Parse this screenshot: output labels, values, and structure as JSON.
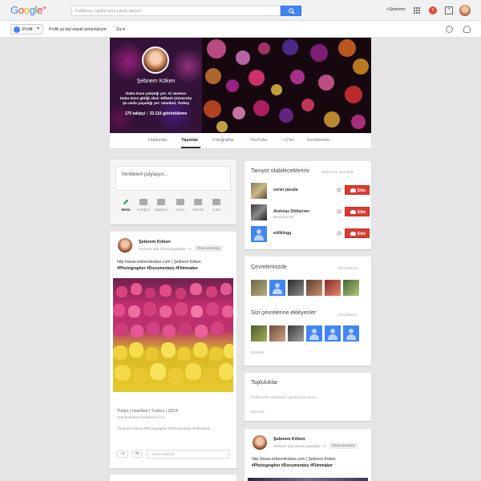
{
  "app": {
    "logo_text": "Google+",
    "search_placeholder": "Kullanıcı, sayfa veya yayın arayın",
    "user_link": "+Şebnem",
    "notification_count": "2"
  },
  "subbar": {
    "profile_label": "Profil",
    "view_as_text": "Profili şu kişi olarak görüntüleyin:",
    "view_as_value": "Siz"
  },
  "cover": {
    "name": "Şebnem Köken",
    "info_lines": [
      "Daha önce çalıştığı yer: Al Jazeera",
      "Daha önce gittiği okul: Bilkent University",
      "Şu anda yaşadığı yer: Istanbul, Turkey"
    ],
    "followers": "175 takipçi",
    "views": "33.116 görüntüleme"
  },
  "tabs": [
    "Hakkında",
    "Yayınlar",
    "Fotoğraflar",
    "YouTube",
    "+1'ler",
    "İncelemeler"
  ],
  "active_tab": "Yayınlar",
  "share_box": {
    "placeholder": "Yenilikleri paylaşın...",
    "actions": [
      "Metin",
      "Fotoğraf",
      "Bağlantı",
      "Video",
      "Etkinlik",
      "Anket"
    ]
  },
  "post": {
    "author": "Şebnem Köken",
    "visibility": "Herkese açık olarak paylaşıldı  -  2",
    "tag": "#Documentary",
    "url": "http://www.sebnemkoken.com | Şebnem Köken",
    "hashtags": "#Photographer #Documentary #Filmmaker",
    "link_title": "Tulips | Istanbul | Turkey | 2014",
    "link_url": "sebnemkoken.wordpress.com",
    "description": "| Şebnem Köken #Photographer #Documentary #Filmmaker",
    "plus_one": "+1",
    "comment_placeholder": "Yorum ekleyin..."
  },
  "pymk": {
    "title": "Tanıyor olabileceklerimi",
    "see_others": "Diğerlerini görüntüle",
    "add_label": "Ekle",
    "people": [
      {
        "name": "soner pacala",
        "sub": ""
      },
      {
        "name": "Andreas Dittberner",
        "sub": "aboutpixel.de"
      },
      {
        "name": "editkingg",
        "sub": ""
      }
    ]
  },
  "circles": {
    "in_title": "Çevrelerinizde",
    "in_count": "323 kullanıcı",
    "added_title": "Sizi çevrelerine ekleyenler",
    "added_count": "175 kullanıcı",
    "edit_label": "Düzenle"
  },
  "communities": {
    "title": "Topluluklar",
    "description": "Profilinizde toplulukları göstermiyorsunuz.",
    "edit_label": "Düzenle"
  },
  "post2": {
    "author": "Şebnem Köken",
    "visibility": "Herkese açık olarak paylaşıldı  -  2",
    "tag": "#Documentary",
    "url": "http://www.sebnemkoken.com | Şebnem Köken",
    "hashtags": "#Photographer #Documentary #Filmmaker"
  },
  "colors": {
    "accent_blue": "#4285f4",
    "add_red": "#d73d32",
    "background": "#e5e5e5"
  }
}
